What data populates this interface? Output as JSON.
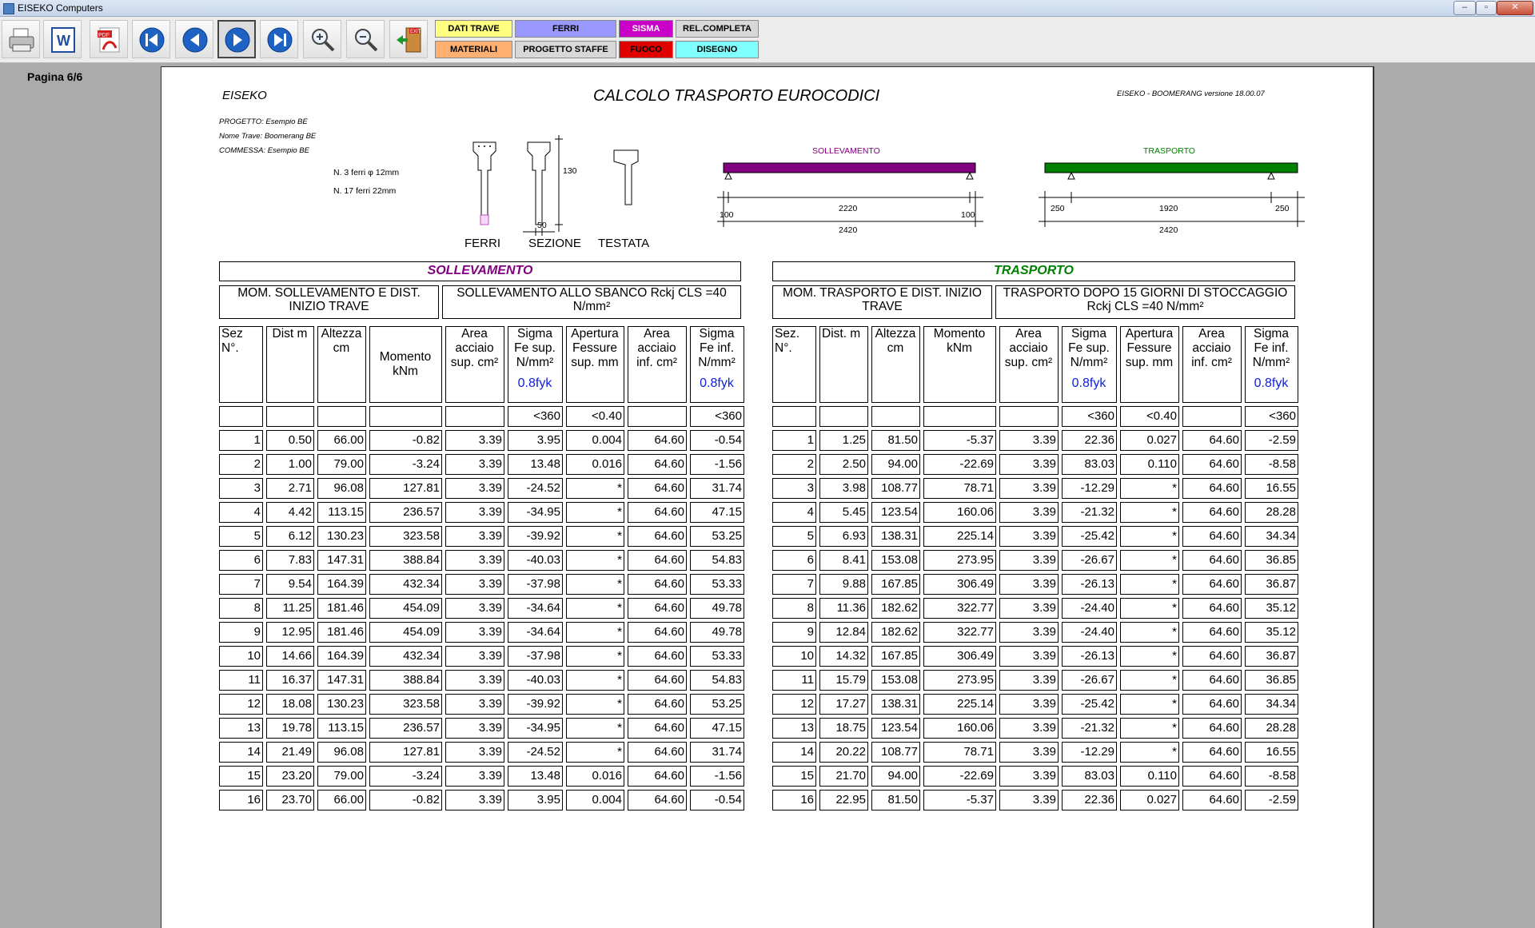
{
  "window": {
    "title": "EISEKO Computers"
  },
  "toolbar": {
    "menu": {
      "dati_trave": "DATI TRAVE",
      "ferri": "FERRI",
      "sisma": "SISMA",
      "rel_completa": "REL.COMPLETA",
      "materiali": "MATERIALI",
      "progetto_staffe": "PROGETTO STAFFE",
      "fuoco": "FUOCO",
      "disegno": "DISEGNO"
    },
    "exit_label": "EXIT",
    "pdf_label": "PDF"
  },
  "colors": {
    "dati_trave": "#ffff80",
    "ferri": "#9898ff",
    "sisma": "#c800c8",
    "rel_completa": "#d8d8d8",
    "materiali": "#ffb070",
    "progetto_staffe": "#d8d8d8",
    "fuoco": "#e00000",
    "disegno": "#80ffff",
    "sollevamento": "#800080",
    "trasporto": "#008000",
    "fyk": "#1020e0"
  },
  "page_label": "Pagina 6/6",
  "report": {
    "brand": "EISEKO",
    "title": "CALCOLO TRASPORTO EUROCODICI",
    "version": "EISEKO - BOOMERANG versione  18.00.07",
    "progetto": "PROGETTO:  Esempio BE",
    "nome_trave": "Nome Trave:  Boomerang BE",
    "commessa": "COMMESSA: Esempio BE",
    "ferri_sup": "N. 3 ferri φ 12mm",
    "ferri_inf": "N. 17 ferri   22mm",
    "sezione_h": "130",
    "sezione_b": "50",
    "label_ferri": "FERRI",
    "label_sezione": "SEZIONE",
    "label_testata": "TESTATA"
  },
  "beam_sollevamento": {
    "label": "SOLLEVAMENTO",
    "left": "100",
    "middle": "2220",
    "right": "100",
    "total": "2420"
  },
  "beam_trasporto": {
    "label": "TRASPORTO",
    "left": "250",
    "middle": "1920",
    "right": "250",
    "total": "2420"
  },
  "sollevamento": {
    "title": "SOLLEVAMENTO",
    "group1": "MOM. SOLLEVAMENTO E DIST. INIZIO TRAVE",
    "group2": "SOLLEVAMENTO ALLO SBANCO  Rckj CLS =40 N/mm²",
    "headers": [
      "Sez N°.",
      "Dist m",
      "Altezza cm",
      "Momento kNm",
      "Area acciaio sup. cm²",
      "Sigma Fe sup. N/mm²",
      "Apertura Fessure sup. mm",
      "Area acciaio inf.  cm²",
      "Sigma Fe inf. N/mm²"
    ],
    "fyk": "0.8fyk",
    "limits": [
      "",
      "",
      "",
      "",
      "",
      "<360",
      "<0.40",
      "",
      "<360"
    ],
    "rows": [
      [
        "1",
        "0.50",
        "66.00",
        "-0.82",
        "3.39",
        "3.95",
        "0.004",
        "64.60",
        "-0.54"
      ],
      [
        "2",
        "1.00",
        "79.00",
        "-3.24",
        "3.39",
        "13.48",
        "0.016",
        "64.60",
        "-1.56"
      ],
      [
        "3",
        "2.71",
        "96.08",
        "127.81",
        "3.39",
        "-24.52",
        "*",
        "64.60",
        "31.74"
      ],
      [
        "4",
        "4.42",
        "113.15",
        "236.57",
        "3.39",
        "-34.95",
        "*",
        "64.60",
        "47.15"
      ],
      [
        "5",
        "6.12",
        "130.23",
        "323.58",
        "3.39",
        "-39.92",
        "*",
        "64.60",
        "53.25"
      ],
      [
        "6",
        "7.83",
        "147.31",
        "388.84",
        "3.39",
        "-40.03",
        "*",
        "64.60",
        "54.83"
      ],
      [
        "7",
        "9.54",
        "164.39",
        "432.34",
        "3.39",
        "-37.98",
        "*",
        "64.60",
        "53.33"
      ],
      [
        "8",
        "11.25",
        "181.46",
        "454.09",
        "3.39",
        "-34.64",
        "*",
        "64.60",
        "49.78"
      ],
      [
        "9",
        "12.95",
        "181.46",
        "454.09",
        "3.39",
        "-34.64",
        "*",
        "64.60",
        "49.78"
      ],
      [
        "10",
        "14.66",
        "164.39",
        "432.34",
        "3.39",
        "-37.98",
        "*",
        "64.60",
        "53.33"
      ],
      [
        "11",
        "16.37",
        "147.31",
        "388.84",
        "3.39",
        "-40.03",
        "*",
        "64.60",
        "54.83"
      ],
      [
        "12",
        "18.08",
        "130.23",
        "323.58",
        "3.39",
        "-39.92",
        "*",
        "64.60",
        "53.25"
      ],
      [
        "13",
        "19.78",
        "113.15",
        "236.57",
        "3.39",
        "-34.95",
        "*",
        "64.60",
        "47.15"
      ],
      [
        "14",
        "21.49",
        "96.08",
        "127.81",
        "3.39",
        "-24.52",
        "*",
        "64.60",
        "31.74"
      ],
      [
        "15",
        "23.20",
        "79.00",
        "-3.24",
        "3.39",
        "13.48",
        "0.016",
        "64.60",
        "-1.56"
      ],
      [
        "16",
        "23.70",
        "66.00",
        "-0.82",
        "3.39",
        "3.95",
        "0.004",
        "64.60",
        "-0.54"
      ]
    ]
  },
  "trasporto": {
    "title": "TRASPORTO",
    "group1": "MOM. TRASPORTO E DIST. INIZIO TRAVE",
    "group2": "TRASPORTO DOPO 15 GIORNI DI STOCCAGGIO  Rckj CLS =40 N/mm²",
    "headers": [
      "Sez. N°.",
      "Dist. m",
      "Altezza cm",
      "Momento kNm",
      "Area acciaio sup. cm²",
      "Sigma Fe sup. N/mm²",
      "Apertura Fessure sup. mm",
      "Area acciaio inf.  cm²",
      "Sigma Fe inf. N/mm²"
    ],
    "fyk": "0.8fyk",
    "limits": [
      "",
      "",
      "",
      "",
      "",
      "<360",
      "<0.40",
      "",
      "<360"
    ],
    "rows": [
      [
        "1",
        "1.25",
        "81.50",
        "-5.37",
        "3.39",
        "22.36",
        "0.027",
        "64.60",
        "-2.59"
      ],
      [
        "2",
        "2.50",
        "94.00",
        "-22.69",
        "3.39",
        "83.03",
        "0.110",
        "64.60",
        "-8.58"
      ],
      [
        "3",
        "3.98",
        "108.77",
        "78.71",
        "3.39",
        "-12.29",
        "*",
        "64.60",
        "16.55"
      ],
      [
        "4",
        "5.45",
        "123.54",
        "160.06",
        "3.39",
        "-21.32",
        "*",
        "64.60",
        "28.28"
      ],
      [
        "5",
        "6.93",
        "138.31",
        "225.14",
        "3.39",
        "-25.42",
        "*",
        "64.60",
        "34.34"
      ],
      [
        "6",
        "8.41",
        "153.08",
        "273.95",
        "3.39",
        "-26.67",
        "*",
        "64.60",
        "36.85"
      ],
      [
        "7",
        "9.88",
        "167.85",
        "306.49",
        "3.39",
        "-26.13",
        "*",
        "64.60",
        "36.87"
      ],
      [
        "8",
        "11.36",
        "182.62",
        "322.77",
        "3.39",
        "-24.40",
        "*",
        "64.60",
        "35.12"
      ],
      [
        "9",
        "12.84",
        "182.62",
        "322.77",
        "3.39",
        "-24.40",
        "*",
        "64.60",
        "35.12"
      ],
      [
        "10",
        "14.32",
        "167.85",
        "306.49",
        "3.39",
        "-26.13",
        "*",
        "64.60",
        "36.87"
      ],
      [
        "11",
        "15.79",
        "153.08",
        "273.95",
        "3.39",
        "-26.67",
        "*",
        "64.60",
        "36.85"
      ],
      [
        "12",
        "17.27",
        "138.31",
        "225.14",
        "3.39",
        "-25.42",
        "*",
        "64.60",
        "34.34"
      ],
      [
        "13",
        "18.75",
        "123.54",
        "160.06",
        "3.39",
        "-21.32",
        "*",
        "64.60",
        "28.28"
      ],
      [
        "14",
        "20.22",
        "108.77",
        "78.71",
        "3.39",
        "-12.29",
        "*",
        "64.60",
        "16.55"
      ],
      [
        "15",
        "21.70",
        "94.00",
        "-22.69",
        "3.39",
        "83.03",
        "0.110",
        "64.60",
        "-8.58"
      ],
      [
        "16",
        "22.95",
        "81.50",
        "-5.37",
        "3.39",
        "22.36",
        "0.027",
        "64.60",
        "-2.59"
      ]
    ]
  }
}
